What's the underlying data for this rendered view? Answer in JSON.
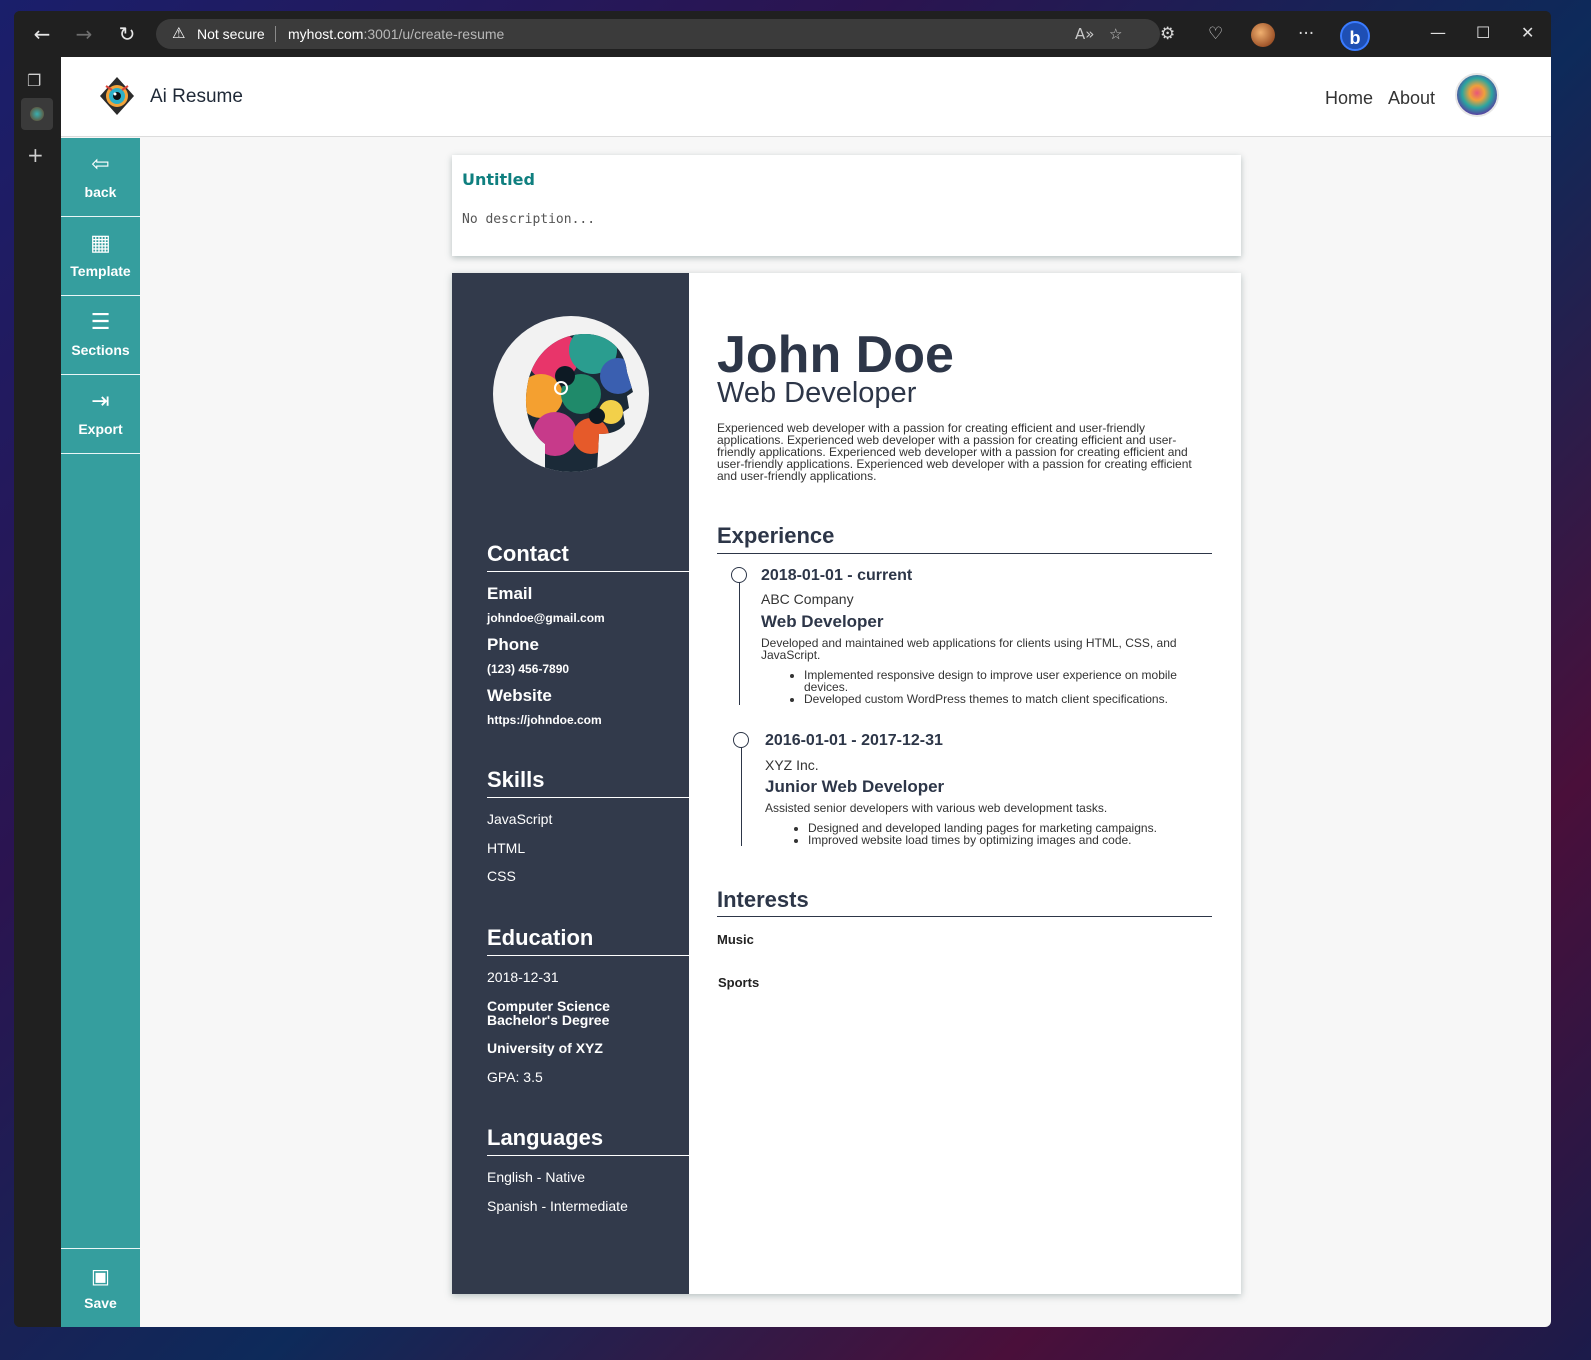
{
  "browser": {
    "security_label": "Not secure",
    "url_host": "myhost.com",
    "url_rest": ":3001/u/create-resume",
    "icons": [
      "back-arrow-icon",
      "forward-arrow-icon",
      "refresh-icon",
      "warning-icon",
      "read-aloud-icon",
      "add-favorite-icon",
      "extensions-icon",
      "browser-essentials-icon",
      "profile-icon",
      "more-icon",
      "bing-icon",
      "minimize-icon",
      "maximize-icon",
      "close-icon"
    ]
  },
  "header": {
    "app_name": "Ai Resume",
    "nav": [
      "Home",
      "About"
    ]
  },
  "sidebar": {
    "items": [
      {
        "label": "back",
        "icon": "back-arrow-icon"
      },
      {
        "label": "Template",
        "icon": "template-icon"
      },
      {
        "label": "Sections",
        "icon": "list-icon"
      },
      {
        "label": "Export",
        "icon": "export-icon"
      }
    ],
    "save_label": "Save"
  },
  "resume_meta": {
    "title": "Untitled",
    "description": "No description..."
  },
  "resume": {
    "name": "John Doe",
    "job_title": "Web Developer",
    "summary": "Experienced web developer with a passion for creating efficient and user-friendly applications. Experienced web developer with a passion for creating efficient and user-friendly applications. Experienced web developer with a passion for creating efficient and user-friendly applications. Experienced web developer with a passion for creating efficient and user-friendly applications.",
    "contact": {
      "heading": "Contact",
      "email_label": "Email",
      "email": "johndoe@gmail.com",
      "phone_label": "Phone",
      "phone": "(123) 456-7890",
      "website_label": "Website",
      "website": "https://johndoe.com"
    },
    "skills": {
      "heading": "Skills",
      "items": [
        "JavaScript",
        "HTML",
        "CSS"
      ]
    },
    "education": {
      "heading": "Education",
      "date": "2018-12-31",
      "degree": "Computer Science Bachelor's Degree",
      "school": "University of XYZ",
      "gpa": "GPA: 3.5"
    },
    "languages": {
      "heading": "Languages",
      "items": [
        "English - Native",
        "Spanish - Intermediate"
      ]
    },
    "experience": {
      "heading": "Experience",
      "jobs": [
        {
          "dates": "2018-01-01 - current",
          "company": "ABC Company",
          "role": "Web Developer",
          "description": "Developed and maintained web applications for clients using HTML, CSS, and JavaScript.",
          "bullets": [
            "Implemented responsive design to improve user experience on mobile devices.",
            "Developed custom WordPress themes to match client specifications."
          ]
        },
        {
          "dates": "2016-01-01 - 2017-12-31",
          "company": "XYZ Inc.",
          "role": "Junior Web Developer",
          "description": "Assisted senior developers with various web development tasks.",
          "bullets": [
            "Designed and developed landing pages for marketing campaigns.",
            "Improved website load times by optimizing images and code."
          ]
        }
      ]
    },
    "interests": {
      "heading": "Interests",
      "items": [
        "Music",
        "Sports"
      ]
    }
  },
  "colors": {
    "sidebar_teal": "#359e9e",
    "resume_dark": "#323a4b",
    "title_teal": "#0f7f7f"
  }
}
